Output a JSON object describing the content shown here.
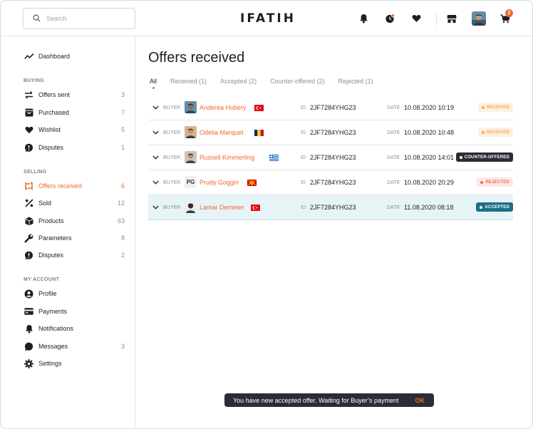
{
  "header": {
    "search_placeholder": "Search",
    "logo": "IFATIH",
    "cart_count": "2",
    "icons": [
      "bell-icon",
      "clock-icon",
      "heart-icon",
      "store-icon",
      "cart-icon"
    ]
  },
  "sidebar": {
    "dashboard": "Dashboard",
    "buying_title": "BUYING",
    "buying": [
      {
        "label": "Offers sent",
        "count": "3",
        "icon": "swap-icon"
      },
      {
        "label": "Purchased",
        "count": "7",
        "icon": "box-icon"
      },
      {
        "label": "Wishlist",
        "count": "5",
        "icon": "heart-icon"
      },
      {
        "label": "Disputes",
        "count": "1",
        "icon": "dispute-icon"
      }
    ],
    "selling_title": "SELLING",
    "selling": [
      {
        "label": "Offers received",
        "count": "6",
        "icon": "swap-icon",
        "active": true
      },
      {
        "label": "Sold",
        "count": "12",
        "icon": "percent-icon"
      },
      {
        "label": "Products",
        "count": "63",
        "icon": "cube-icon"
      },
      {
        "label": "Parameters",
        "count": "8",
        "icon": "wrench-icon"
      },
      {
        "label": "Disputes",
        "count": "2",
        "icon": "dispute-icon"
      }
    ],
    "account_title": "MY ACCOUNT",
    "account": [
      {
        "label": "Profile",
        "count": "",
        "icon": "user-icon"
      },
      {
        "label": "Payments",
        "count": "",
        "icon": "card-icon"
      },
      {
        "label": "Notifications",
        "count": "",
        "icon": "bell-icon"
      },
      {
        "label": "Messages",
        "count": "3",
        "icon": "chat-icon"
      },
      {
        "label": "Settings",
        "count": "",
        "icon": "gear-icon"
      }
    ]
  },
  "main": {
    "title": "Offers received",
    "tabs": [
      "All",
      "Received (1)",
      "Accepted (2)",
      "Counter-offered (2)",
      "Rejected (1)"
    ],
    "buyer_label": "BUYER",
    "id_label": "ID",
    "date_label": "DATE",
    "rows": [
      {
        "name": "Anderea Hubery",
        "id": "2JF7284YHG23",
        "date": "10.08.2020 10:19",
        "status": "RECEIVED",
        "kind": "received",
        "flag": "tr",
        "avatar": "photo",
        "skin": "#8a6a55",
        "bg": "#5e8fa8"
      },
      {
        "name": "Odelia Marquet",
        "id": "2JF7284YHG23",
        "date": "10.08.2020 10:48",
        "status": "RECEIVED",
        "kind": "received",
        "flag": "ro",
        "avatar": "photo",
        "skin": "#c8946c",
        "bg": "#d9b48f"
      },
      {
        "name": "Russell Kimmerling",
        "id": "2JF7284YHG23",
        "date": "10.08.2020 14:01",
        "status": "COUNTER-OFFERED",
        "kind": "counter",
        "flag": "gr",
        "avatar": "photo",
        "skin": "#b98a70",
        "bg": "#c9c3bd"
      },
      {
        "name": "Prudy Goggin",
        "id": "2JF7284YHG23",
        "date": "10.08.2020 20:29",
        "status": "REJECTED",
        "kind": "rejected",
        "flag": "mk",
        "avatar": "initials",
        "initials": "PG"
      },
      {
        "name": "Lamar Demeter",
        "id": "2JF7284YHG23",
        "date": "11.08.2020 08:18",
        "status": "ACCEPTED",
        "kind": "accepted",
        "flag": "tr",
        "avatar": "photo",
        "skin": "#3a2a22",
        "bg": "#e8eef0"
      }
    ]
  },
  "toast": {
    "message": "You have new accepted offer. Waiting for Buyer’s payment",
    "action": "OK"
  },
  "colors": {
    "accent": "#f06a2a",
    "highlight_row": "#e6f4f7",
    "accepted": "#1d6f86",
    "counter": "#2a2d34"
  }
}
